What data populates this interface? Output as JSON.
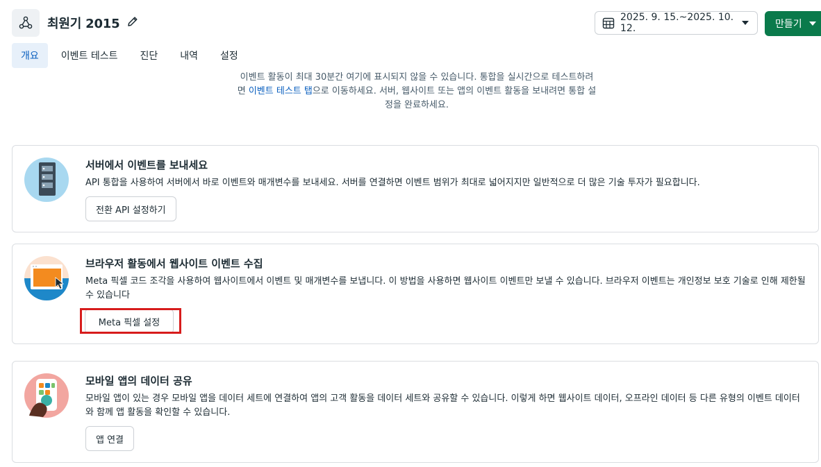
{
  "header": {
    "title": "최원기 2015",
    "date_range": "2025. 9. 15.~2025. 10. 12.",
    "create_label": "만들기"
  },
  "tabs": [
    {
      "label": "개요",
      "active": true
    },
    {
      "label": "이벤트 테스트"
    },
    {
      "label": "진단"
    },
    {
      "label": "내역"
    },
    {
      "label": "설정"
    }
  ],
  "notice": {
    "line1": "이벤트 활동이 최대 30분간 여기에 표시되지 않을 수 있습니다. 통합을 실시간으로 테스트하려",
    "line2_prefix": "면 ",
    "line2_link": "이벤트 테스트 탭",
    "line2_suffix": "으로 이동하세요. 서버, 웹사이트 또는 앱의 이벤트 활동을 보내려면 통합 설",
    "line3": "정을 완료하세요."
  },
  "cards": [
    {
      "title": "서버에서 이벤트를 보내세요",
      "description": "API 통합을 사용하여 서버에서 바로 이벤트와 매개변수를 보내세요. 서버를 연결하면 이벤트 범위가 최대로 넓어지지만 일반적으로 더 많은 기술 투자가 필요합니다.",
      "button": "전환 API 설정하기"
    },
    {
      "title": "브라우저 활동에서 웹사이트 이벤트 수집",
      "description": "Meta 픽셀 코드 조각을 사용하여 웹사이트에서 이벤트 및 매개변수를 보냅니다. 이 방법을 사용하면 웹사이트 이벤트만 보낼 수 있습니다. 브라우저 이벤트는 개인정보 보호 기술로 인해 제한될 수 있습니다",
      "button": "Meta 픽셀 설정"
    },
    {
      "title": "모바일 앱의 데이터 공유",
      "description": "모바일 앱이 있는 경우 모바일 앱을 데이터 세트에 연결하여 앱의 고객 활동을 데이터 세트와 공유할 수 있습니다. 이렇게 하면 웹사이트 데이터, 오프라인 데이터 등 다른 유형의 이벤트 데이터와 함께 앱 활동을 확인할 수 있습니다.",
      "button": "앱 연결"
    }
  ],
  "colors": {
    "primary_green": "#0a7a4b",
    "link_blue": "#0a5fbf",
    "highlight_red": "#d71c1c"
  }
}
